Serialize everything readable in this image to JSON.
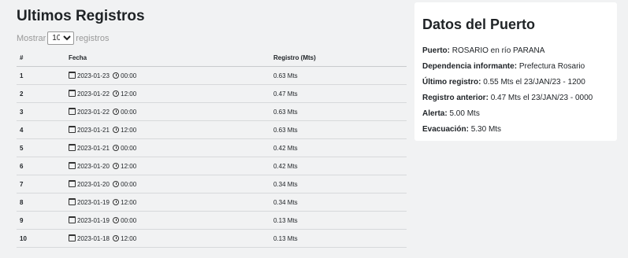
{
  "registros": {
    "title": "Ultimos Registros",
    "length_prefix": "Mostrar",
    "length_value": "10",
    "length_suffix": "registros",
    "columns": [
      "#",
      "Fecha",
      "Registro (Mts)"
    ],
    "rows": [
      {
        "n": "1",
        "date": "2023-01-23",
        "time": "00:00",
        "value": "0.63 Mts"
      },
      {
        "n": "2",
        "date": "2023-01-22",
        "time": "12:00",
        "value": "0.47 Mts"
      },
      {
        "n": "3",
        "date": "2023-01-22",
        "time": "00:00",
        "value": "0.63 Mts"
      },
      {
        "n": "4",
        "date": "2023-01-21",
        "time": "12:00",
        "value": "0.63 Mts"
      },
      {
        "n": "5",
        "date": "2023-01-21",
        "time": "00:00",
        "value": "0.42 Mts"
      },
      {
        "n": "6",
        "date": "2023-01-20",
        "time": "12:00",
        "value": "0.42 Mts"
      },
      {
        "n": "7",
        "date": "2023-01-20",
        "time": "00:00",
        "value": "0.34 Mts"
      },
      {
        "n": "8",
        "date": "2023-01-19",
        "time": "12:00",
        "value": "0.34 Mts"
      },
      {
        "n": "9",
        "date": "2023-01-19",
        "time": "00:00",
        "value": "0.13 Mts"
      },
      {
        "n": "10",
        "date": "2023-01-18",
        "time": "12:00",
        "value": "0.13 Mts"
      }
    ]
  },
  "puerto": {
    "title": "Datos del Puerto",
    "fields": [
      {
        "label": "Puerto:",
        "value": "ROSARIO en río PARANA"
      },
      {
        "label": "Dependencia informante:",
        "value": "Prefectura Rosario"
      },
      {
        "label": "Último registro:",
        "value": "0.55 Mts el 23/JAN/23 - 1200"
      },
      {
        "label": "Registro anterior:",
        "value": "0.47 Mts el 23/JAN/23 - 0000"
      },
      {
        "label": "Alerta:",
        "value": "5.00 Mts"
      },
      {
        "label": "Evacuación:",
        "value": "5.30 Mts"
      }
    ]
  }
}
